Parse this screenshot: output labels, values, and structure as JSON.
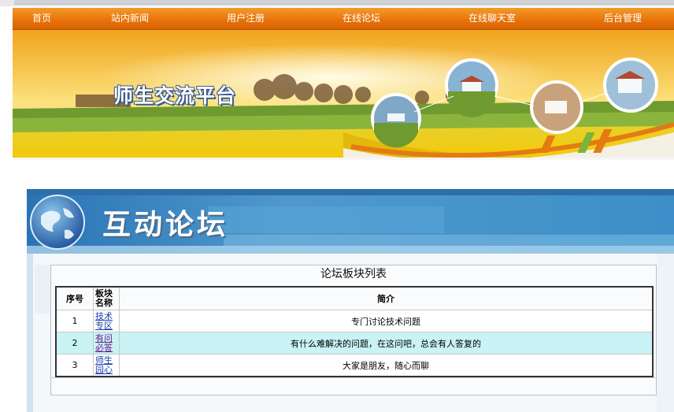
{
  "nav": {
    "items": [
      "首页",
      "站内新闻",
      "用户注册",
      "在线论坛",
      "在线聊天室",
      "后台管理"
    ]
  },
  "banner": {
    "title": "师生交流平台"
  },
  "forum": {
    "title": "互动论坛"
  },
  "board_list": {
    "title": "论坛板块列表",
    "headers": [
      "序号",
      "板块名称",
      "简介"
    ],
    "rows": [
      {
        "no": "1",
        "name": "技术专区",
        "desc": "专门讨论技术问题"
      },
      {
        "no": "2",
        "name": "有问必答",
        "desc": "有什么难解决的问题，在这问吧，总会有人答复的"
      },
      {
        "no": "3",
        "name": "师生园心",
        "desc": "大家是朋友，随心而聊"
      }
    ]
  },
  "colors": {
    "nav_orange": "#e8740b",
    "highlight_row": "#c9f3f5",
    "link": "#1a3fb0",
    "visited_link": "#6a1a8a"
  }
}
